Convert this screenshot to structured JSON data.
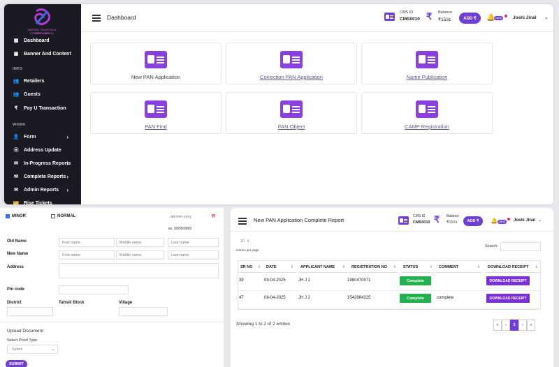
{
  "brand": {
    "line1": "MADHAV TAXATION & SERVICES",
    "line2": "PRIVATE LIMITED"
  },
  "sidebar": {
    "items": [
      {
        "label": "Dashboard",
        "icon": "dashboard-icon"
      },
      {
        "label": "Banner And Content",
        "icon": "image-icon"
      },
      {
        "section": "INFO"
      },
      {
        "label": "Retailers",
        "icon": "users-icon"
      },
      {
        "label": "Guests",
        "icon": "users-icon"
      },
      {
        "label": "Pay U Transaction",
        "icon": "rupee-icon"
      },
      {
        "section": "WORK"
      },
      {
        "label": "Form",
        "icon": "user-plus-icon",
        "chevron": "›"
      },
      {
        "label": "Address Update",
        "icon": "location-icon"
      },
      {
        "label": "In-Progress Reports",
        "icon": "mail-icon",
        "chevron": "›"
      },
      {
        "label": "Complete Reports",
        "icon": "mail-icon",
        "chevron": "›"
      },
      {
        "label": "Admin Reports",
        "icon": "mail-icon",
        "chevron": "›"
      },
      {
        "label": "Rise Tickets",
        "icon": "ticket-icon"
      }
    ]
  },
  "header": {
    "title": "Dashboard",
    "cms_label": "CMS ID",
    "cms_id": "CMS0010",
    "balance_label": "Balance",
    "balance": "₹1531",
    "add_label": "ADD ₹",
    "user": "Joshi Jinal",
    "badge": "NEW"
  },
  "cards": [
    "New PAN Application",
    "Correction PAN Application",
    "Name Publication",
    "PAN Find",
    "PAN Object",
    "CAMP Registration"
  ],
  "form": {
    "minor": "MINOR",
    "normal": "NORMAL",
    "date_placeholder": "dd-mm-yyyy",
    "date_hint": "ex. 99/99/9999",
    "old_name": "Old Name",
    "new_name": "New Name",
    "first": "First name",
    "middle": "Middle name",
    "last": "Last name",
    "address": "Address",
    "pincode": "Pin code",
    "district": "District",
    "tahsil": "Tahsil/ Block",
    "village": "Village",
    "upload": "Upload Document",
    "proof": "Select Proof Type",
    "select": "Select",
    "submit": "SUBMIT"
  },
  "report": {
    "title": "New PAN Application Complete Report",
    "cms_label": "CMS ID",
    "cms_id": "CMS0010",
    "balance_label": "Balance",
    "balance": "₹1531",
    "add_label": "ADD ₹",
    "user": "Joshi Jinal",
    "badge": "NEW",
    "entries": "10",
    "entries_label": "entries per page",
    "search": "Search:",
    "headers": [
      "SR NO",
      "DATE",
      "APPLICANT NAME",
      "REGISTRATION NO",
      "STATUS",
      "COMMENT",
      "DOWNLOAD RECEIPT"
    ],
    "rows": [
      {
        "sr": "39",
        "date": "09-04-2025",
        "name": "JH J J",
        "reg": "1980470971",
        "status": "Complete",
        "comment": "",
        "btn": "DOWNLOAD RECEIPT"
      },
      {
        "sr": "47",
        "date": "08-04-2025",
        "name": "JH J J",
        "reg": "1542984325",
        "status": "Complete",
        "comment": "complete",
        "btn": "DOWNLOAD RECEIPT"
      }
    ],
    "showing": "Showing 1 to 2 of 2 entries",
    "pages": [
      "«",
      "‹",
      "1",
      "›",
      "»"
    ]
  },
  "colors": {
    "accent": "#6f3fd1",
    "sidebar": "#1a1b22",
    "success": "#22b14c"
  }
}
